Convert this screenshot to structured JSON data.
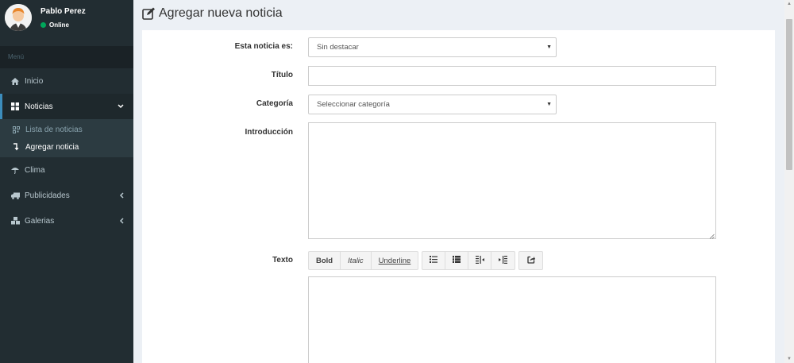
{
  "user": {
    "name": "Pablo Perez",
    "status": "Online"
  },
  "sidebar": {
    "menu_header": "Menú",
    "items": [
      {
        "label": "Inicio",
        "icon": "home-icon"
      },
      {
        "label": "Noticias",
        "icon": "grid-icon",
        "active": true
      },
      {
        "label": "Clima",
        "icon": "umbrella-icon"
      },
      {
        "label": "Publicidades",
        "icon": "truck-icon"
      },
      {
        "label": "Galerias",
        "icon": "cubes-icon"
      }
    ],
    "submenu": [
      {
        "label": "Lista de noticias",
        "icon": "qrcode-icon"
      },
      {
        "label": "Agregar noticia",
        "icon": "level-down-icon",
        "current": true
      }
    ]
  },
  "page": {
    "title": "Agregar nueva noticia",
    "icon": "edit-icon"
  },
  "form": {
    "featured": {
      "label": "Esta noticia es:",
      "value": "Sin destacar"
    },
    "title": {
      "label": "Título",
      "value": ""
    },
    "category": {
      "label": "Categoría",
      "value": "Seleccionar categoría"
    },
    "intro": {
      "label": "Introducción",
      "value": ""
    },
    "text": {
      "label": "Texto",
      "value": ""
    }
  },
  "editor_toolbar": {
    "bold": "Bold",
    "italic": "Italic",
    "underline": "Underline",
    "buttons": [
      "unordered-list-icon",
      "ordered-list-icon",
      "outdent-icon",
      "indent-icon",
      "share-icon"
    ]
  },
  "colors": {
    "sidebar": "#222d32",
    "accent": "#3c8dbc",
    "online": "#00a65a",
    "content_bg": "#ecf0f5"
  }
}
